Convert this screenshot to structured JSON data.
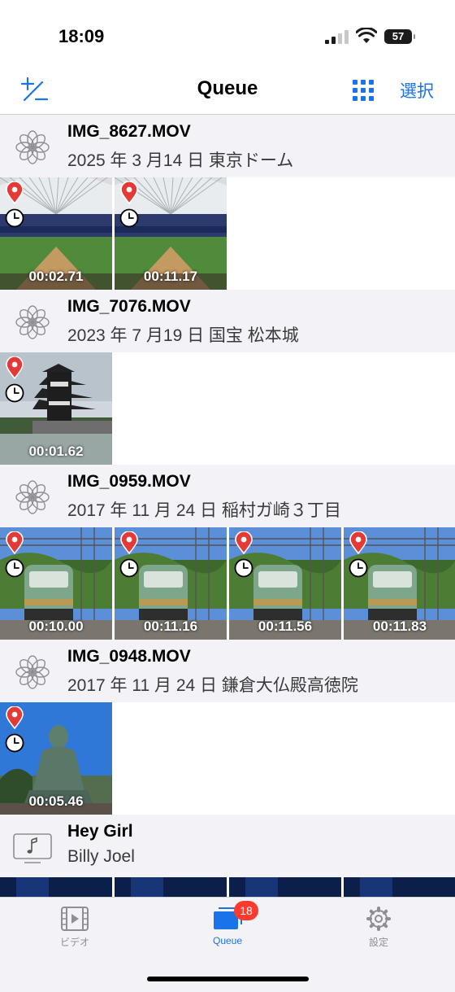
{
  "status": {
    "time": "18:09",
    "battery": "57"
  },
  "nav": {
    "title": "Queue",
    "select_label": "選択"
  },
  "sections": [
    {
      "name": "IMG_8627.MOV",
      "subtitle": "2025 年 3 月14 日 東京ドーム",
      "icon": "flower-icon",
      "thumbs": [
        {
          "time": "00:02.71",
          "scene": "stadium"
        },
        {
          "time": "00:11.17",
          "scene": "stadium"
        }
      ]
    },
    {
      "name": "IMG_7076.MOV",
      "subtitle": "2023 年 7 月19 日 国宝 松本城",
      "icon": "flower-icon",
      "thumbs": [
        {
          "time": "00:01.62",
          "scene": "castle"
        }
      ]
    },
    {
      "name": "IMG_0959.MOV",
      "subtitle": "2017 年 11 月 24 日 稲村ガ崎３丁目",
      "icon": "flower-icon",
      "thumbs": [
        {
          "time": "00:10.00",
          "scene": "train"
        },
        {
          "time": "00:11.16",
          "scene": "train"
        },
        {
          "time": "00:11.56",
          "scene": "train"
        },
        {
          "time": "00:11.83",
          "scene": "train"
        }
      ]
    },
    {
      "name": "IMG_0948.MOV",
      "subtitle": "2017 年 11 月 24 日 鎌倉大仏殿高徳院",
      "icon": "flower-icon",
      "thumbs": [
        {
          "time": "00:05.46",
          "scene": "buddha"
        }
      ]
    },
    {
      "name": "Hey Girl",
      "subtitle": "Billy Joel",
      "icon": "music-icon",
      "thumbs": [
        {
          "time": "",
          "scene": "concert"
        },
        {
          "time": "",
          "scene": "concert"
        },
        {
          "time": "",
          "scene": "concert"
        },
        {
          "time": "",
          "scene": "concert"
        }
      ]
    }
  ],
  "tabs": [
    {
      "label": "ビデオ",
      "icon": "film-icon",
      "active": false
    },
    {
      "label": "Queue",
      "icon": "queue-icon",
      "active": true,
      "badge": "18"
    },
    {
      "label": "設定",
      "icon": "gear-icon",
      "active": false
    }
  ],
  "colors": {
    "accent": "#1a73e8",
    "badge": "#ff3b30",
    "section_bg": "#f2f2f7"
  }
}
